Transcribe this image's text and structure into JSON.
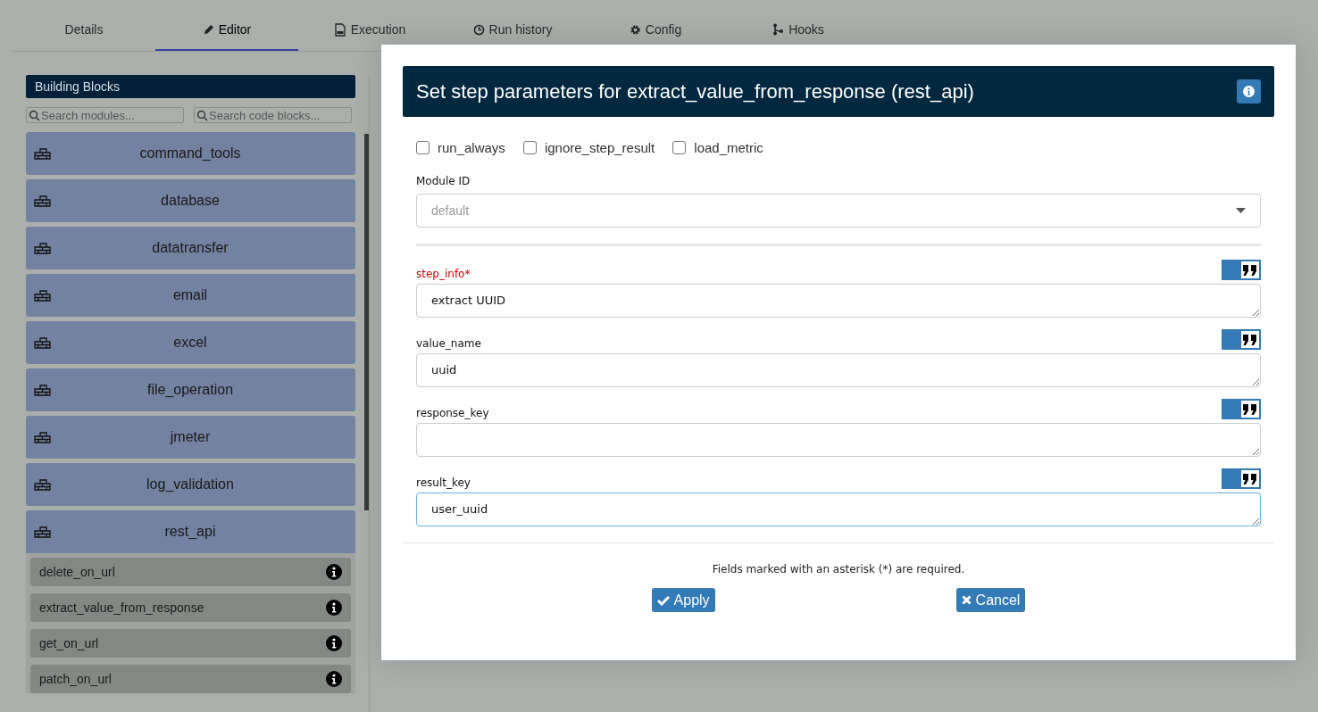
{
  "tabs": [
    {
      "label": "Details",
      "selected": false
    },
    {
      "label": "Editor",
      "selected": true
    },
    {
      "label": "Execution",
      "selected": false
    },
    {
      "label": "Run history",
      "selected": false
    },
    {
      "label": "Config",
      "selected": false
    },
    {
      "label": "Hooks",
      "selected": false
    }
  ],
  "palette": {
    "title": "Building Blocks",
    "module_search": {
      "placeholder": "Search modules..."
    },
    "code_search": {
      "placeholder": "Search code blocks..."
    },
    "modules": [
      {
        "name": "command_tools",
        "expanded": false
      },
      {
        "name": "database",
        "expanded": false
      },
      {
        "name": "datatransfer",
        "expanded": false
      },
      {
        "name": "email",
        "expanded": false
      },
      {
        "name": "excel",
        "expanded": false
      },
      {
        "name": "file_operation",
        "expanded": false
      },
      {
        "name": "jmeter",
        "expanded": false
      },
      {
        "name": "log_validation",
        "expanded": false
      },
      {
        "name": "rest_api",
        "expanded": true,
        "children": [
          {
            "name": "delete_on_url"
          },
          {
            "name": "extract_value_from_response"
          },
          {
            "name": "get_on_url"
          },
          {
            "name": "patch_on_url"
          }
        ]
      }
    ]
  },
  "dialog": {
    "title": "Set step parameters for extract_value_from_response (rest_api)",
    "options": [
      {
        "label": "run_always",
        "checked": false
      },
      {
        "label": "ignore_step_result",
        "checked": false
      },
      {
        "label": "load_metric",
        "checked": false
      }
    ],
    "module_id": {
      "label": "Module ID",
      "placeholder": "default"
    },
    "params": [
      {
        "label": "step_info*",
        "required": true,
        "value": "extract UUID",
        "literal": true,
        "focused": false
      },
      {
        "label": "value_name",
        "required": false,
        "value": "uuid",
        "literal": true,
        "focused": false
      },
      {
        "label": "response_key",
        "required": false,
        "literal": true,
        "focused": false
      },
      {
        "label": "result_key",
        "required": false,
        "value": "user_uuid",
        "literal": true,
        "focused": true
      }
    ],
    "note": "Fields marked with an asterisk (*) are required.",
    "buttons": [
      {
        "label": "Apply",
        "kind": "apply"
      },
      {
        "label": "Cancel",
        "kind": "cancel"
      }
    ]
  }
}
